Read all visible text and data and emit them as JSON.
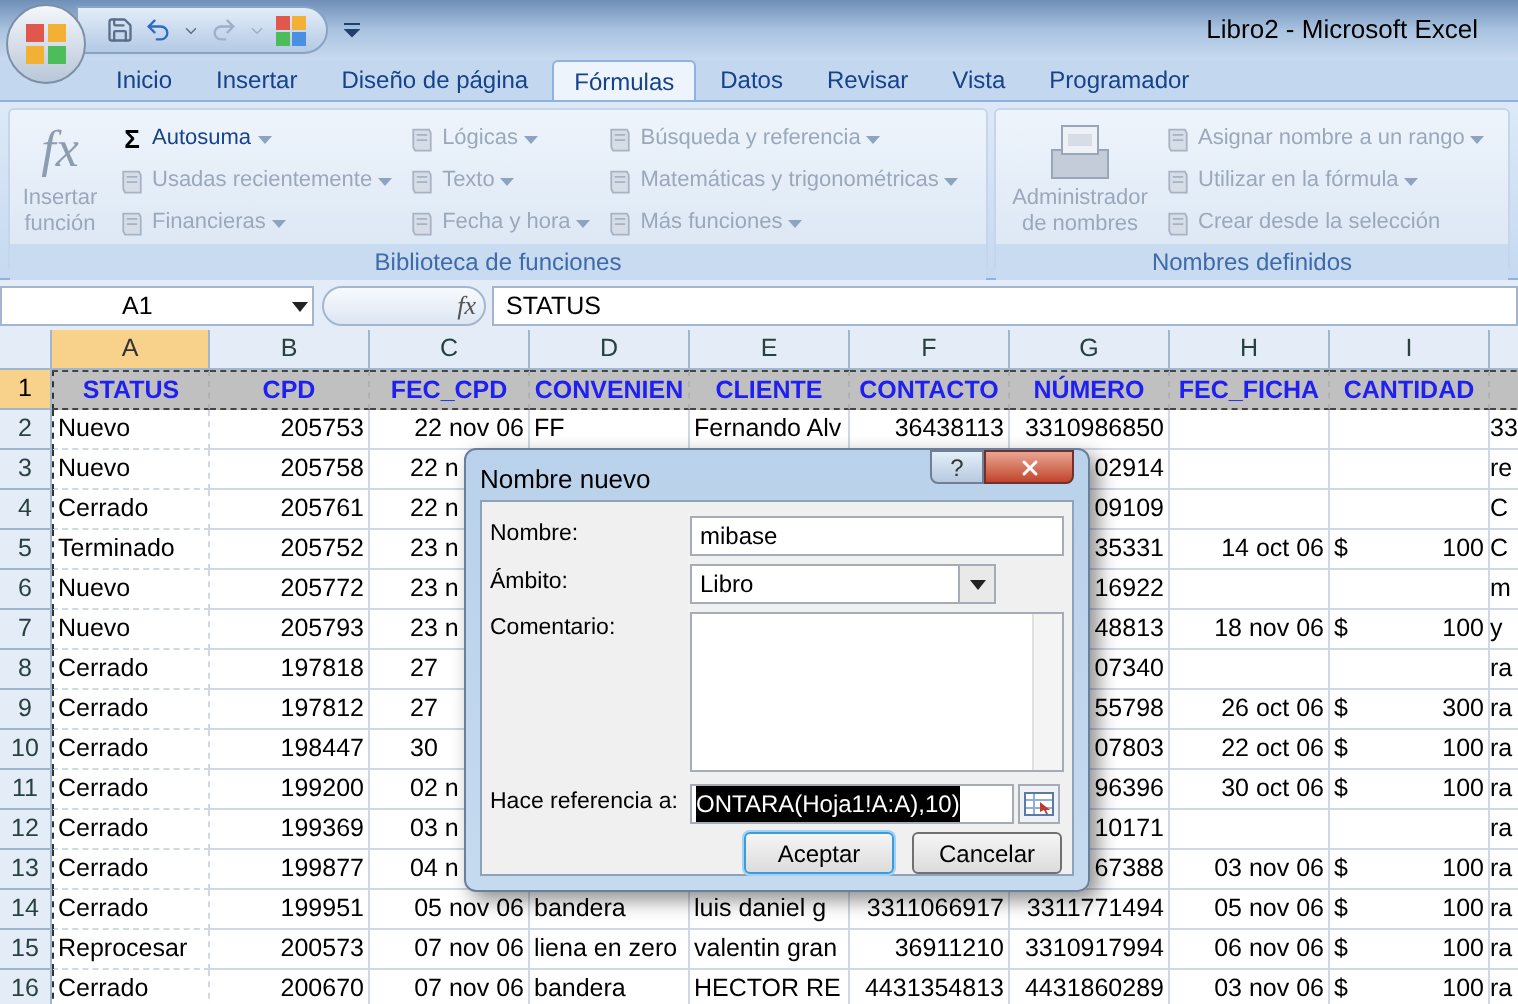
{
  "window": {
    "title": "Libro2 - Microsoft Excel"
  },
  "ribbon": {
    "tabs": [
      {
        "label": "Inicio",
        "selected": false
      },
      {
        "label": "Insertar",
        "selected": false
      },
      {
        "label": "Diseño de página",
        "selected": false
      },
      {
        "label": "Fórmulas",
        "selected": true
      },
      {
        "label": "Datos",
        "selected": false
      },
      {
        "label": "Revisar",
        "selected": false
      },
      {
        "label": "Vista",
        "selected": false
      },
      {
        "label": "Programador",
        "selected": false
      }
    ],
    "groups": [
      {
        "label": "Biblioteca de funciones",
        "large_button": {
          "label": "Insertar función",
          "icon_text": "fx",
          "disabled": true
        },
        "columns": [
          [
            {
              "label": "Autosuma",
              "icon_text": "Σ",
              "dropdown": true,
              "disabled": false
            },
            {
              "label": "Usadas recientemente",
              "dropdown": true,
              "disabled": true
            },
            {
              "label": "Financieras",
              "dropdown": true,
              "disabled": true
            }
          ],
          [
            {
              "label": "Lógicas",
              "dropdown": true,
              "disabled": true
            },
            {
              "label": "Texto",
              "dropdown": true,
              "disabled": true
            },
            {
              "label": "Fecha y hora",
              "dropdown": true,
              "disabled": true
            }
          ],
          [
            {
              "label": "Búsqueda y referencia",
              "dropdown": true,
              "disabled": true
            },
            {
              "label": "Matemáticas y trigonométricas",
              "dropdown": true,
              "disabled": true
            },
            {
              "label": "Más funciones",
              "dropdown": true,
              "disabled": true
            }
          ]
        ]
      },
      {
        "label": "Nombres definidos",
        "large_button": {
          "label": "Administrador de nombres",
          "disabled": true
        },
        "columns": [
          [
            {
              "label": "Asignar nombre a un rango",
              "dropdown": true,
              "disabled": true
            },
            {
              "label": "Utilizar en la fórmula",
              "dropdown": true,
              "disabled": true
            },
            {
              "label": "Crear desde la selección",
              "dropdown": false,
              "disabled": true
            }
          ]
        ]
      }
    ]
  },
  "formula_bar": {
    "name_box": "A1",
    "fx": "fx",
    "value": "STATUS"
  },
  "sheet": {
    "columns": [
      {
        "label": "A",
        "selected": true
      },
      {
        "label": "B",
        "selected": false
      },
      {
        "label": "C",
        "selected": false
      },
      {
        "label": "D",
        "selected": false
      },
      {
        "label": "E",
        "selected": false
      },
      {
        "label": "F",
        "selected": false
      },
      {
        "label": "G",
        "selected": false
      },
      {
        "label": "H",
        "selected": false
      },
      {
        "label": "I",
        "selected": false
      }
    ],
    "rows": [
      {
        "number": "1",
        "selected": true,
        "kind": "header",
        "cells": [
          "STATUS",
          "CPD",
          "FEC_CPD",
          "CONVENIEN",
          "CLIENTE",
          "CONTACTO",
          "NÚMERO",
          "FEC_FICHA",
          "CANTIDAD",
          null
        ]
      },
      {
        "number": "2",
        "selected": false,
        "kind": "data",
        "covered": false,
        "cells": [
          "Nuevo",
          "205753",
          "22 nov 06",
          "FF",
          "Fernando Alv",
          "36438113",
          "3310986850",
          null,
          null,
          "33"
        ]
      },
      {
        "number": "3",
        "selected": false,
        "kind": "data",
        "covered": true,
        "cells": [
          "Nuevo",
          "205758",
          "22 n",
          null,
          null,
          null,
          "02914",
          null,
          null,
          "re"
        ]
      },
      {
        "number": "4",
        "selected": false,
        "kind": "data",
        "covered": true,
        "cells": [
          "Cerrado",
          "205761",
          "22 n",
          null,
          null,
          null,
          "09109",
          null,
          null,
          "C"
        ]
      },
      {
        "number": "5",
        "selected": false,
        "kind": "data",
        "covered": true,
        "cells": [
          "Terminado",
          "205752",
          "23 n",
          null,
          null,
          null,
          "35331",
          "14 oct 06",
          [
            "$",
            "100"
          ],
          "C"
        ]
      },
      {
        "number": "6",
        "selected": false,
        "kind": "data",
        "covered": true,
        "cells": [
          "Nuevo",
          "205772",
          "23 n",
          null,
          null,
          null,
          "16922",
          null,
          null,
          "m"
        ]
      },
      {
        "number": "7",
        "selected": false,
        "kind": "data",
        "covered": true,
        "cells": [
          "Nuevo",
          "205793",
          "23 n",
          null,
          null,
          null,
          "48813",
          "18 nov 06",
          [
            "$",
            "100"
          ],
          "y"
        ]
      },
      {
        "number": "8",
        "selected": false,
        "kind": "data",
        "covered": true,
        "cells": [
          "Cerrado",
          "197818",
          "27",
          null,
          null,
          null,
          "07340",
          null,
          null,
          "ra"
        ]
      },
      {
        "number": "9",
        "selected": false,
        "kind": "data",
        "covered": true,
        "cells": [
          "Cerrado",
          "197812",
          "27",
          null,
          null,
          null,
          "55798",
          "26 oct 06",
          [
            "$",
            "300"
          ],
          "ra"
        ]
      },
      {
        "number": "10",
        "selected": false,
        "kind": "data",
        "covered": true,
        "cells": [
          "Cerrado",
          "198447",
          "30",
          null,
          null,
          null,
          "07803",
          "22 oct 06",
          [
            "$",
            "100"
          ],
          "ra"
        ]
      },
      {
        "number": "11",
        "selected": false,
        "kind": "data",
        "covered": true,
        "cells": [
          "Cerrado",
          "199200",
          "02 n",
          null,
          null,
          null,
          "96396",
          "30 oct 06",
          [
            "$",
            "100"
          ],
          "ra"
        ]
      },
      {
        "number": "12",
        "selected": false,
        "kind": "data",
        "covered": true,
        "cells": [
          "Cerrado",
          "199369",
          "03 n",
          null,
          null,
          null,
          "10171",
          null,
          null,
          "ra"
        ]
      },
      {
        "number": "13",
        "selected": false,
        "kind": "data",
        "covered": true,
        "cells": [
          "Cerrado",
          "199877",
          "04 n",
          null,
          null,
          null,
          "67388",
          "03 nov 06",
          [
            "$",
            "100"
          ],
          "ra"
        ]
      },
      {
        "number": "14",
        "selected": false,
        "kind": "data",
        "covered": false,
        "cells": [
          "Cerrado",
          "199951",
          "05 nov 06",
          "bandera",
          "luis daniel g",
          "3311066917",
          "3311771494",
          "05 nov 06",
          [
            "$",
            "100"
          ],
          "ra"
        ]
      },
      {
        "number": "15",
        "selected": false,
        "kind": "data",
        "covered": false,
        "cells": [
          "Reprocesar",
          "200573",
          "07 nov 06",
          "liena en zero",
          "valentin gran",
          "36911210",
          "3310917994",
          "06 nov 06",
          [
            "$",
            "100"
          ],
          "ra"
        ]
      },
      {
        "number": "16",
        "selected": false,
        "kind": "data",
        "covered": false,
        "cells": [
          "Cerrado",
          "200670",
          "07 nov 06",
          "bandera",
          "HECTOR RE",
          "4431354813",
          "4431860289",
          "03 nov 06",
          [
            "$",
            "100"
          ],
          "ra"
        ]
      }
    ]
  },
  "dialog": {
    "title": "Nombre nuevo",
    "help": "?",
    "fields": [
      {
        "kind": "text",
        "label": "Nombre:",
        "value": "mibase"
      },
      {
        "kind": "select",
        "label": "Ámbito:",
        "value": "Libro"
      },
      {
        "kind": "textarea",
        "label": "Comentario:"
      },
      {
        "kind": "reference",
        "label": "Hace referencia a:",
        "value": "ONTARA(Hoja1!A:A),10)",
        "selected": true
      }
    ],
    "buttons": [
      {
        "label": "Aceptar",
        "default": true
      },
      {
        "label": "Cancelar",
        "default": false
      }
    ]
  }
}
